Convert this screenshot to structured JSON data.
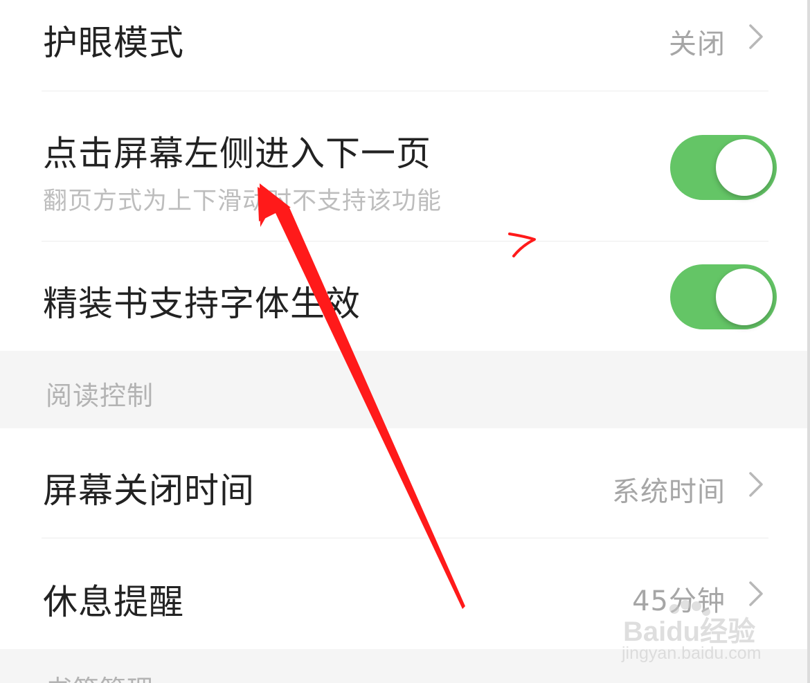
{
  "settings": {
    "eye_mode": {
      "label": "护眼模式",
      "value": "关闭"
    },
    "tap_left": {
      "label": "点击屏幕左侧进入下一页",
      "hint": "翻页方式为上下滑动时不支持该功能",
      "enabled": true
    },
    "font_effect": {
      "label": "精装书支持字体生效",
      "enabled": true
    }
  },
  "reading_control": {
    "title": "阅读控制",
    "screen_off": {
      "label": "屏幕关闭时间",
      "value": "系统时间"
    },
    "rest_reminder": {
      "label": "休息提醒",
      "value": "45分钟"
    }
  },
  "bookmark_section": {
    "title": "书签管理"
  },
  "watermark": {
    "brand": "Baidu经验",
    "site": "jingyan.baidu.com"
  },
  "colors": {
    "toggle_on": "#64c566",
    "annotation": "#ff1a1a"
  }
}
